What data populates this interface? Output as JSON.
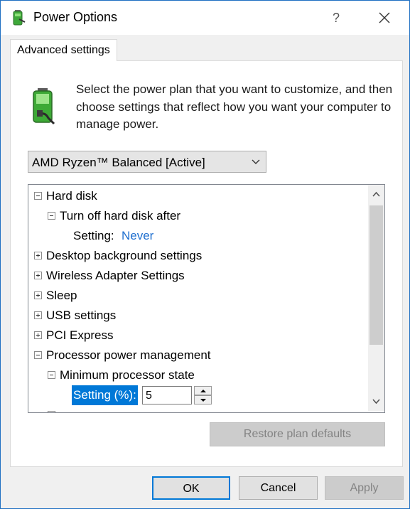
{
  "window": {
    "title": "Power Options",
    "help": "?",
    "icon": "power-battery-icon"
  },
  "tab": {
    "label": "Advanced settings"
  },
  "intro": "Select the power plan that you want to customize, and then choose settings that reflect how you want your computer to manage power.",
  "plan": {
    "selected": "AMD Ryzen™ Balanced [Active]"
  },
  "tree": {
    "hard_disk": "Hard disk",
    "turn_off_hard_disk": "Turn off hard disk after",
    "setting_label": "Setting:",
    "setting_value": "Never",
    "desktop_bg": "Desktop background settings",
    "wireless": "Wireless Adapter Settings",
    "sleep": "Sleep",
    "usb": "USB settings",
    "pci": "PCI Express",
    "processor": "Processor power management",
    "min_processor": "Minimum processor state",
    "pct_label": "Setting (%):",
    "pct_value": "5"
  },
  "buttons": {
    "restore": "Restore plan defaults",
    "ok": "OK",
    "cancel": "Cancel",
    "apply": "Apply"
  },
  "colors": {
    "accent": "#0078d7",
    "link": "#1f6fcf"
  }
}
